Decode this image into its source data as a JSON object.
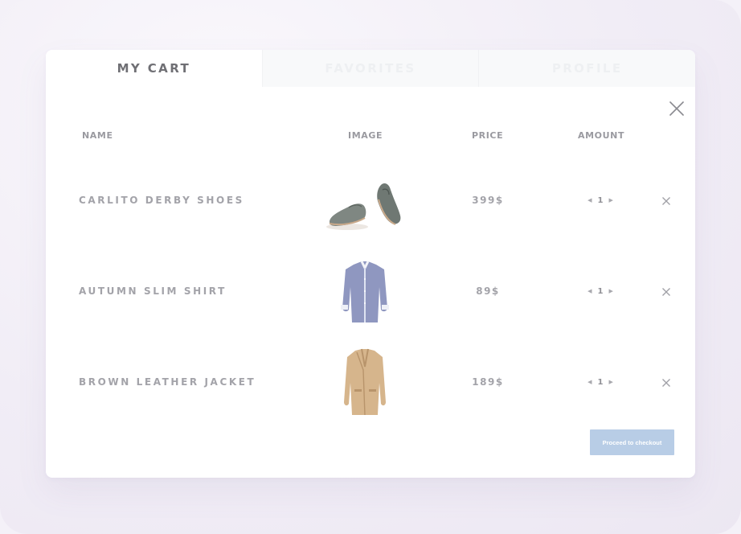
{
  "tabs": [
    {
      "label": "MY CART",
      "active": true
    },
    {
      "label": "FAVORITES",
      "active": false
    },
    {
      "label": "PROFILE",
      "active": false
    }
  ],
  "columns": {
    "name": "NAME",
    "image": "IMAGE",
    "price": "PRICE",
    "amount": "AMOUNT"
  },
  "items": [
    {
      "name": "CARLITO DERBY SHOES",
      "image_icon": "shoes-image",
      "price": "399$",
      "quantity": "1"
    },
    {
      "name": "AUTUMN SLIM SHIRT",
      "image_icon": "shirt-image",
      "price": "89$",
      "quantity": "1"
    },
    {
      "name": "BROWN LEATHER JACKET",
      "image_icon": "jacket-image",
      "price": "189$",
      "quantity": "1"
    }
  ],
  "checkout_label": "Proceed to checkout",
  "colors": {
    "accent_button": "#b8cde6",
    "text_muted": "#a3a3a9",
    "background": "#f4f1f8"
  }
}
